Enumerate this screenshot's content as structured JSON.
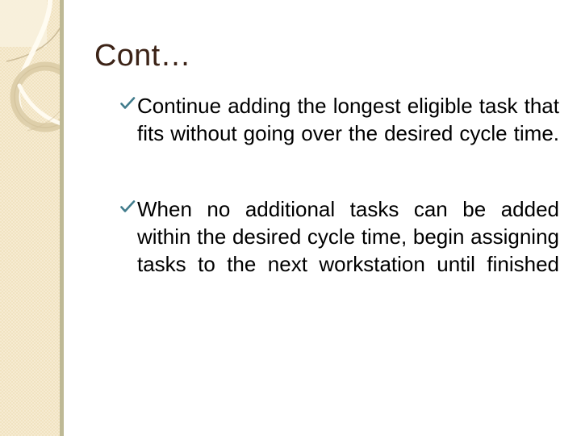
{
  "slide": {
    "title": "Cont…",
    "title_color": "#3C2317",
    "background_color": "#FFFFFF",
    "body_text_color": "#000000",
    "bullet_icon": "check-icon",
    "bullet_icon_color": "#417C8C",
    "sidebar": {
      "base_color": "#F0E2BE",
      "highlight_color": "#F7EED6",
      "edge_color": "#BDB894",
      "ring_color": "#D9C9A3",
      "arc_light_color": "#FFFBF0",
      "arc_thin_color": "#C9B894"
    },
    "bullets": [
      {
        "icon": "check-icon",
        "text": "Continue adding the longest eligible task that fits without going over the desired cycle time."
      },
      {
        "icon": "check-icon",
        "text": "When no additional tasks can be added within the desired cycle time, begin assigning tasks to the next workstation until finished"
      }
    ]
  }
}
